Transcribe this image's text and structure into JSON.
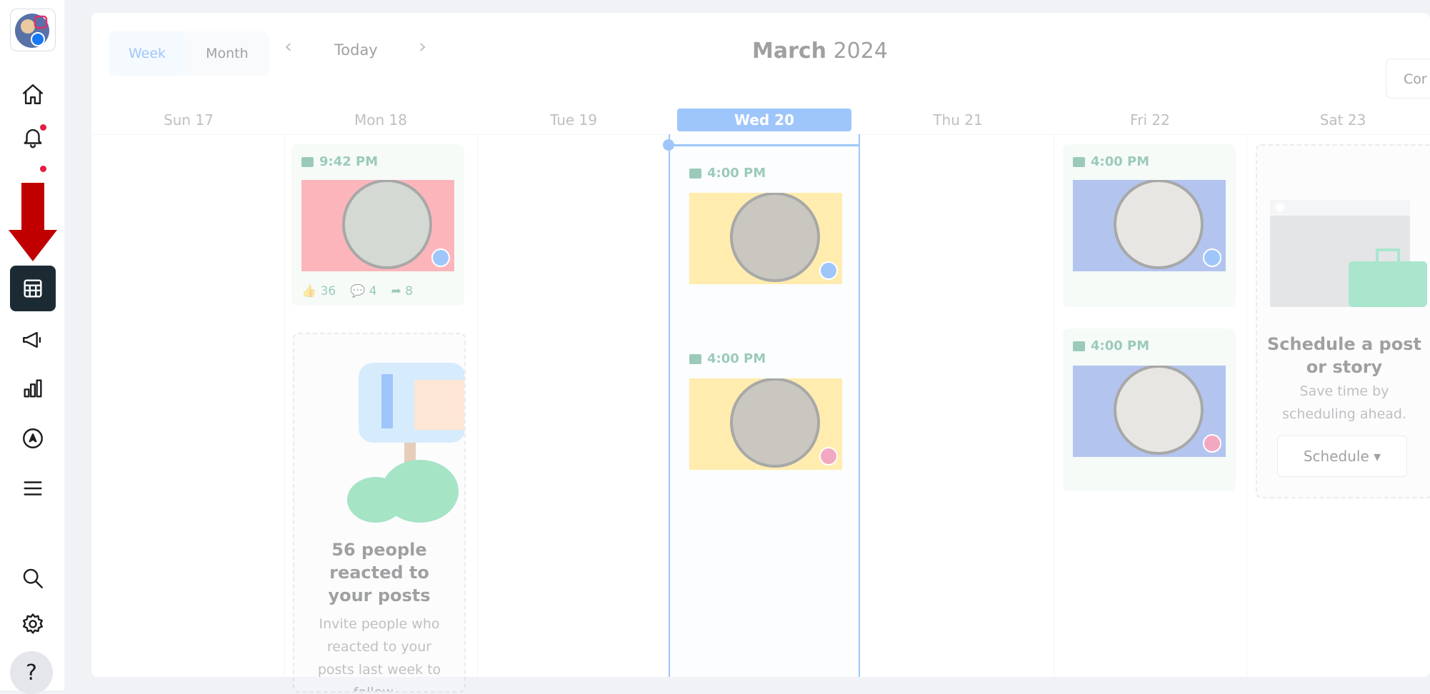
{
  "sidebar": {
    "items": [
      {
        "name": "home-icon"
      },
      {
        "name": "notifications-icon"
      },
      {
        "name": "inbox-icon"
      },
      {
        "name": "planner-icon"
      },
      {
        "name": "ads-icon"
      },
      {
        "name": "insights-icon"
      },
      {
        "name": "navigate-icon"
      },
      {
        "name": "menu-icon"
      },
      {
        "name": "search-icon"
      },
      {
        "name": "settings-icon"
      }
    ],
    "help_label": "?"
  },
  "header": {
    "view_week": "Week",
    "view_month": "Month",
    "today": "Today",
    "prev": "‹",
    "next": "›",
    "title_month": "March",
    "title_year": "2024",
    "corner_button": "Cor"
  },
  "days": [
    "Sun 17",
    "Mon 18",
    "Tue 19",
    "Wed 20",
    "Thu 21",
    "Fri 22",
    "Sat 23"
  ],
  "posts": {
    "mon": {
      "time": "9:42 PM",
      "likes": "36",
      "comments": "4",
      "shares": "8"
    },
    "wed1": {
      "time": "4:00 PM"
    },
    "wed2": {
      "time": "4:00 PM"
    },
    "fri1": {
      "time": "4:00 PM"
    },
    "fri2": {
      "time": "4:00 PM"
    }
  },
  "reach_card": {
    "title": "56 people reacted to your posts",
    "body": "Invite people who reacted to your posts last week to follow..."
  },
  "schedule_card": {
    "title": "Schedule a post or story",
    "body": "Save time by scheduling ahead.",
    "button": "Schedule"
  },
  "colors": {
    "accent": "#1877f2",
    "post_bg": "#e9f6ef",
    "post_text": "#12805c",
    "active_nav": "#1c2b33",
    "arrow": "#c00000"
  }
}
